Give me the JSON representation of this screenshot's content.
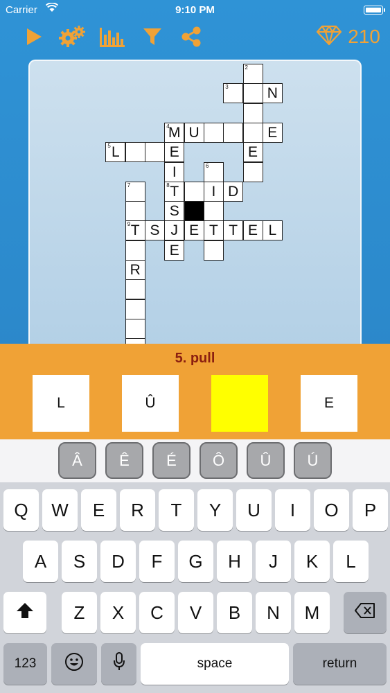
{
  "status_bar": {
    "carrier": "Carrier",
    "time": "9:10 PM"
  },
  "toolbar": {
    "icons": [
      "play-icon",
      "gears-icon",
      "stats-icon",
      "filter-icon",
      "share-icon"
    ],
    "accent_color": "#f0a236",
    "gem_count": "210"
  },
  "clue": {
    "text": "5. pull",
    "boxes": [
      {
        "letter": "L",
        "active": false
      },
      {
        "letter": "Û",
        "active": false
      },
      {
        "letter": "",
        "active": true
      },
      {
        "letter": "E",
        "active": false
      }
    ],
    "active_color": "#ffff00"
  },
  "accent_keys": [
    "Â",
    "Ê",
    "É",
    "Ô",
    "Û",
    "Ú"
  ],
  "keyboard": {
    "row1": [
      "Q",
      "W",
      "E",
      "R",
      "T",
      "Y",
      "U",
      "I",
      "O",
      "P"
    ],
    "row2": [
      "A",
      "S",
      "D",
      "F",
      "G",
      "H",
      "J",
      "K",
      "L"
    ],
    "row3": [
      "Z",
      "X",
      "C",
      "V",
      "B",
      "N",
      "M"
    ],
    "numbers_label": "123",
    "space_label": "space",
    "return_label": "return"
  },
  "grid": {
    "cells": [
      {
        "col": 10,
        "row": 0,
        "number": "2"
      },
      {
        "col": 9,
        "row": 1,
        "number": "3"
      },
      {
        "col": 10,
        "row": 1
      },
      {
        "col": 11,
        "row": 1,
        "letter": "N"
      },
      {
        "col": 10,
        "row": 2
      },
      {
        "col": 6,
        "row": 3,
        "number": "4",
        "letter": "M"
      },
      {
        "col": 7,
        "row": 3,
        "letter": "U"
      },
      {
        "col": 8,
        "row": 3
      },
      {
        "col": 9,
        "row": 3
      },
      {
        "col": 10,
        "row": 3
      },
      {
        "col": 11,
        "row": 3,
        "letter": "E"
      },
      {
        "col": 3,
        "row": 4,
        "number": "5",
        "letter": "L"
      },
      {
        "col": 4,
        "row": 4
      },
      {
        "col": 5,
        "row": 4
      },
      {
        "col": 6,
        "row": 4,
        "letter": "E"
      },
      {
        "col": 10,
        "row": 4,
        "letter": "E"
      },
      {
        "col": 6,
        "row": 5,
        "letter": "I"
      },
      {
        "col": 8,
        "row": 5,
        "number": "6"
      },
      {
        "col": 10,
        "row": 5
      },
      {
        "col": 4,
        "row": 6,
        "number": "7"
      },
      {
        "col": 6,
        "row": 6,
        "number": "8",
        "letter": "T"
      },
      {
        "col": 7,
        "row": 6
      },
      {
        "col": 8,
        "row": 6,
        "letter": "I"
      },
      {
        "col": 9,
        "row": 6,
        "letter": "D"
      },
      {
        "col": 4,
        "row": 7
      },
      {
        "col": 6,
        "row": 7,
        "letter": "S"
      },
      {
        "col": 7,
        "row": 7,
        "black": true
      },
      {
        "col": 8,
        "row": 7
      },
      {
        "col": 4,
        "row": 8,
        "number": "9",
        "letter": "T"
      },
      {
        "col": 5,
        "row": 8,
        "letter": "S"
      },
      {
        "col": 6,
        "row": 8,
        "letter": "J"
      },
      {
        "col": 7,
        "row": 8,
        "letter": "E"
      },
      {
        "col": 8,
        "row": 8,
        "letter": "T"
      },
      {
        "col": 9,
        "row": 8,
        "letter": "T"
      },
      {
        "col": 10,
        "row": 8,
        "letter": "E"
      },
      {
        "col": 11,
        "row": 8,
        "letter": "L"
      },
      {
        "col": 4,
        "row": 9
      },
      {
        "col": 6,
        "row": 9,
        "letter": "E"
      },
      {
        "col": 8,
        "row": 9
      },
      {
        "col": 4,
        "row": 10,
        "letter": "R"
      },
      {
        "col": 4,
        "row": 11
      },
      {
        "col": 4,
        "row": 12
      },
      {
        "col": 4,
        "row": 13
      },
      {
        "col": 4,
        "row": 14
      }
    ]
  }
}
